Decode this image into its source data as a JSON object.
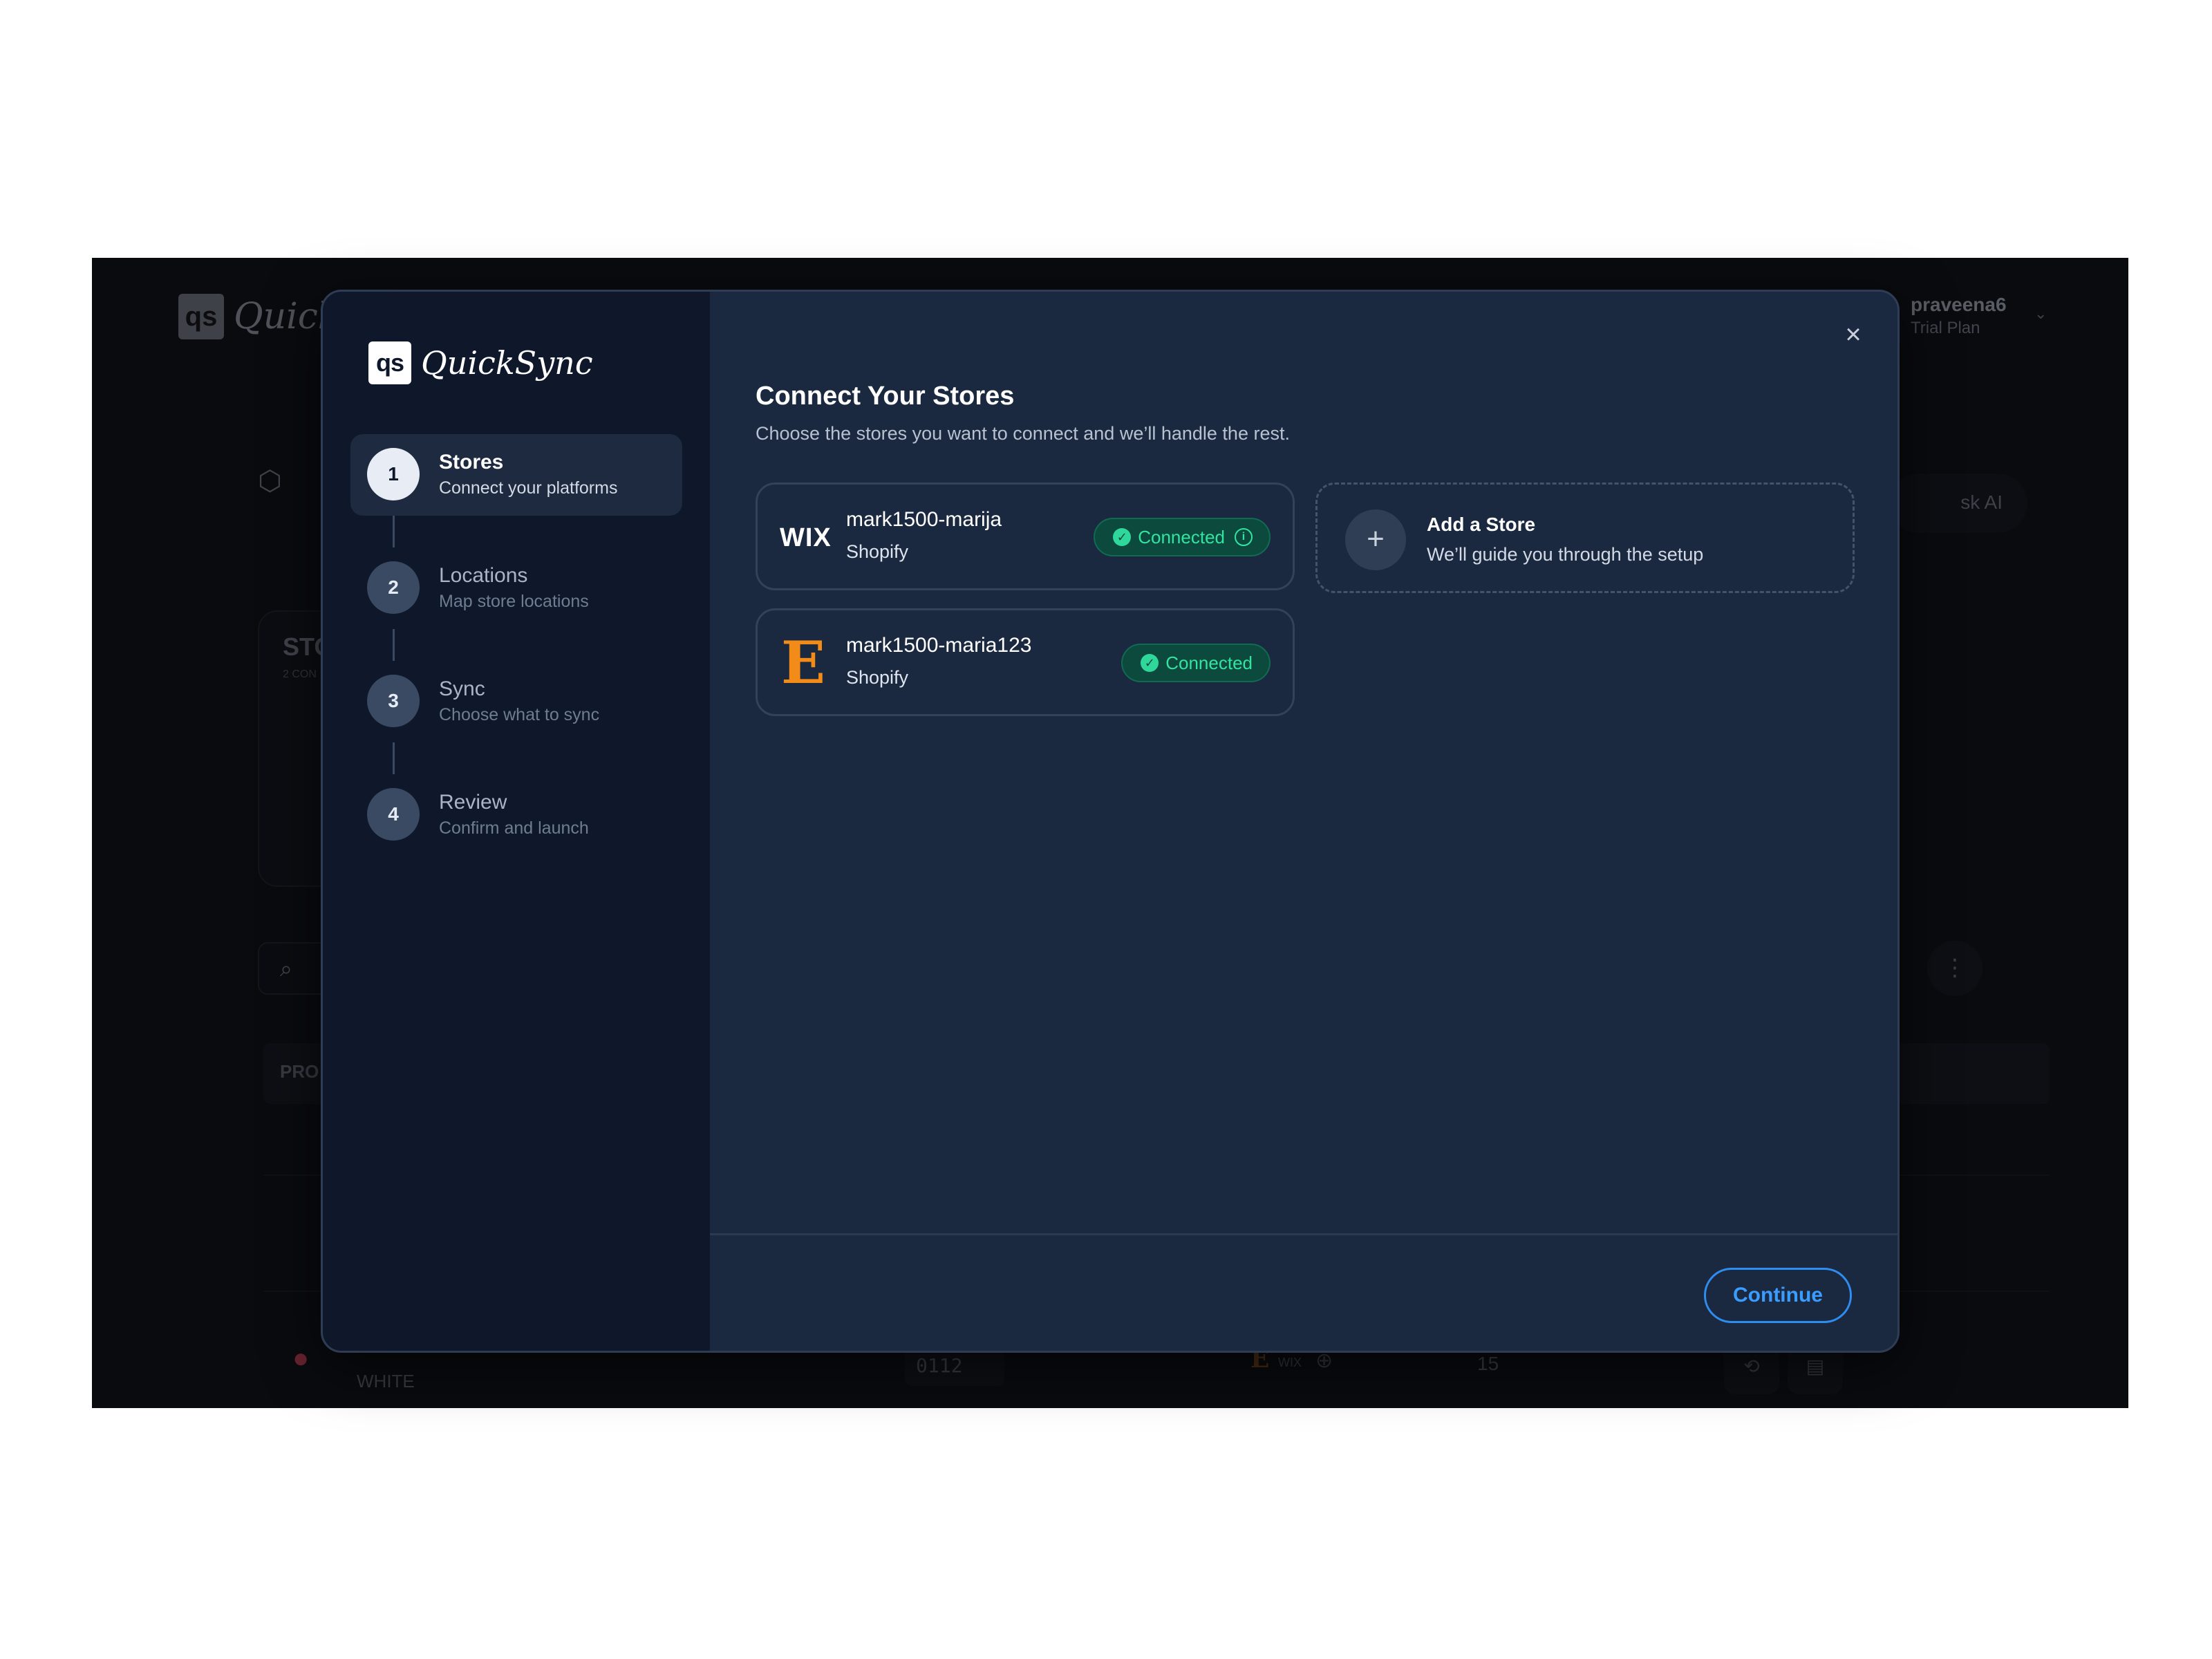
{
  "background": {
    "brand_short": "qs",
    "brand_name": "QuickS",
    "user_name": "praveena6",
    "user_plan": "Trial Plan",
    "stores_card_title": "STO",
    "stores_card_sub": "2 CON",
    "table_header_first": "PRO",
    "ask_ai_label": "sk AI",
    "row_variant": "WHITE",
    "row_sku": "0112",
    "row_channel_wix": "WIX",
    "row_qty": "15"
  },
  "modal": {
    "brand_short": "qs",
    "brand_name": "QuickSync",
    "close_label": "×",
    "title": "Connect Your Stores",
    "subtitle": "Choose the stores you want to connect and we’ll handle the rest.",
    "steps": [
      {
        "number": "1",
        "title": "Stores",
        "subtitle": "Connect your platforms",
        "active": true
      },
      {
        "number": "2",
        "title": "Locations",
        "subtitle": "Map store locations",
        "active": false
      },
      {
        "number": "3",
        "title": "Sync",
        "subtitle": "Choose what to sync",
        "active": false
      },
      {
        "number": "4",
        "title": "Review",
        "subtitle": "Confirm and launch",
        "active": false
      }
    ],
    "stores": [
      {
        "logo_text": "WIX",
        "name": "mark1500-marija",
        "platform": "Shopify",
        "status": "Connected",
        "icon": "wix-logo-icon"
      },
      {
        "logo_text": "E",
        "name": "mark1500-maria123",
        "platform": "Shopify",
        "status": "Connected",
        "icon": "etsy-logo-icon"
      }
    ],
    "add_store": {
      "plus": "+",
      "title": "Add a Store",
      "subtitle": "We’ll guide you through the setup"
    },
    "continue_label": "Continue"
  },
  "colors": {
    "modal_bg": "#1b2940",
    "sidebar_bg": "#0e182a",
    "connected_green": "#34e3a0",
    "accent_blue": "#3b9cff",
    "etsy_orange": "#f28b17"
  }
}
